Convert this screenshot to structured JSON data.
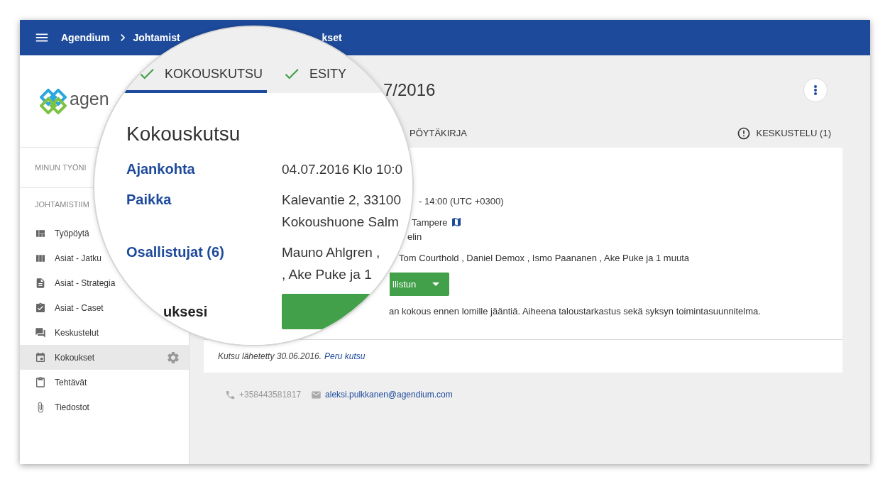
{
  "topbar": {
    "app_name": "Agendium",
    "breadcrumb": [
      "Johtamist",
      "kset"
    ]
  },
  "sidebar": {
    "logo_text": "agen",
    "sections": [
      {
        "title": "MINUN TYÖNI"
      },
      {
        "title": "JOHTAMISTIIM",
        "items": [
          {
            "label": "Työpöytä",
            "selected": false
          },
          {
            "label": "Asiat - Jatku",
            "selected": false
          },
          {
            "label": "Asiat - Strategia",
            "selected": false
          },
          {
            "label": "Asiat - Caset",
            "selected": false
          },
          {
            "label": "Keskustelut",
            "selected": false
          },
          {
            "label": "Kokoukset",
            "selected": true
          },
          {
            "label": "Tehtävät",
            "selected": false
          },
          {
            "label": "Tiedostot",
            "selected": false
          }
        ]
      }
    ]
  },
  "page": {
    "title": "7/2016",
    "tabs": [
      {
        "label": "PÖYTÄKIRJA"
      }
    ],
    "discussion": "KESKUSTELU (1)"
  },
  "card": {
    "time": "- 14:00 (UTC +0300)",
    "place": "Tampere",
    "room": "elin",
    "participants": "Tom Courthold , Daniel Demox , Ismo Paananen , Ake Puke ja 1 muuta",
    "button": "llistun",
    "description": "an kokous ennen lomille jääntiä. Aiheena taloustarkastus sekä syksyn toimintasuunnitelma.",
    "footer": {
      "text": "Kutsu lähetetty 30.06.2016.",
      "link": "Peru kutsu"
    }
  },
  "contact": {
    "phone": "+358443581817",
    "email": "aleksi.pulkkanen@agendium.com"
  },
  "magnifier": {
    "tabs": [
      {
        "label": "KOKOUSKUTSU",
        "done": true,
        "selected": true
      },
      {
        "label": "ESITY",
        "done": true,
        "selected": false
      }
    ],
    "heading": "Kokouskutsu",
    "fields": [
      {
        "label": "Ajankohta",
        "values": [
          "04.07.2016 Klo 10:0"
        ]
      },
      {
        "label": "Paikka",
        "values": [
          "Kalevantie 2, 33100",
          "Kokoushuone Salm"
        ]
      },
      {
        "label": "Osallistujat (6)",
        "values": [
          "Mauno Ahlgren ,",
          ", Ake Puke ja 1"
        ]
      }
    ],
    "response_label": "uksesi"
  }
}
